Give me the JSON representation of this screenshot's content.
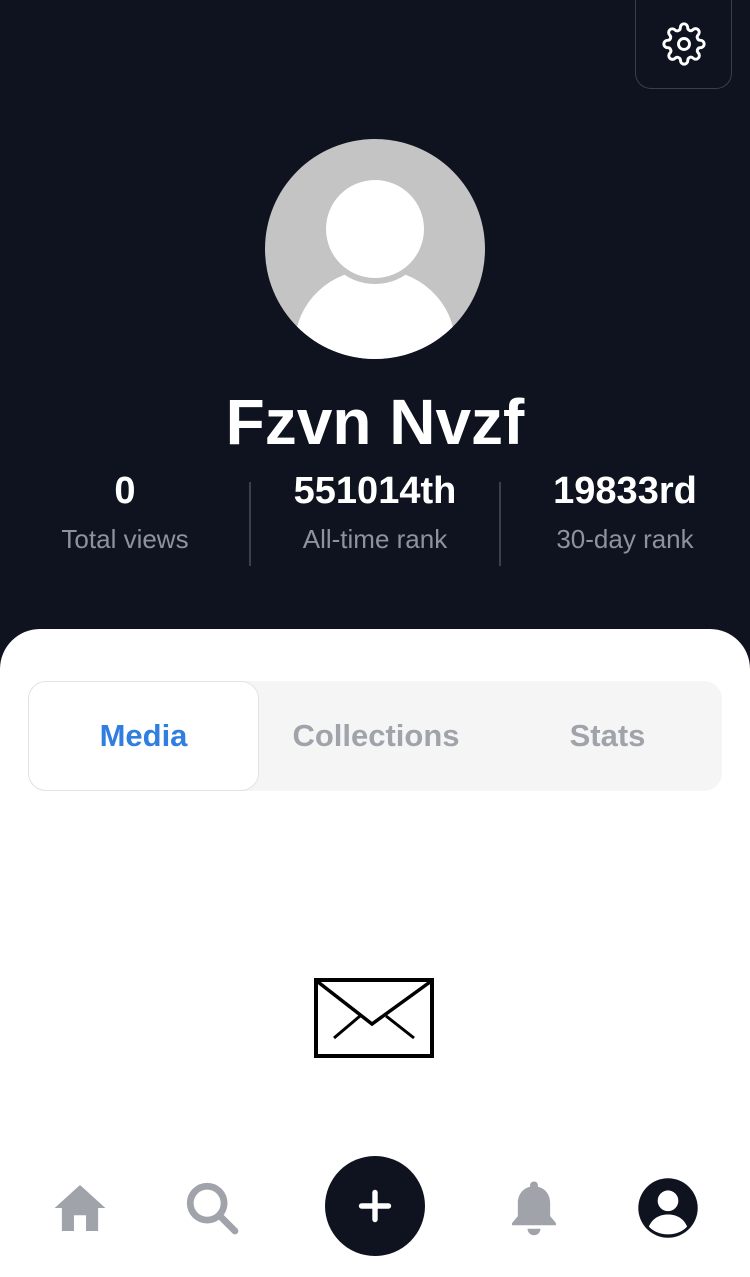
{
  "profile": {
    "name": "Fzvn Nvzf"
  },
  "stats": [
    {
      "value": "0",
      "label": "Total views"
    },
    {
      "value": "551014th",
      "label": "All-time rank"
    },
    {
      "value": "19833rd",
      "label": "30-day rank"
    }
  ],
  "tabs": [
    {
      "label": "Media",
      "active": true
    },
    {
      "label": "Collections",
      "active": false
    },
    {
      "label": "Stats",
      "active": false
    }
  ],
  "empty_state": {
    "icon": "envelope-icon"
  },
  "nav": {
    "items": [
      "home-icon",
      "search-icon",
      "add-icon",
      "bell-icon",
      "profile-icon"
    ],
    "active": "profile-icon"
  },
  "colors": {
    "header_bg": "#0f1320",
    "accent": "#2f7ee0",
    "muted": "#a0a3aa"
  }
}
